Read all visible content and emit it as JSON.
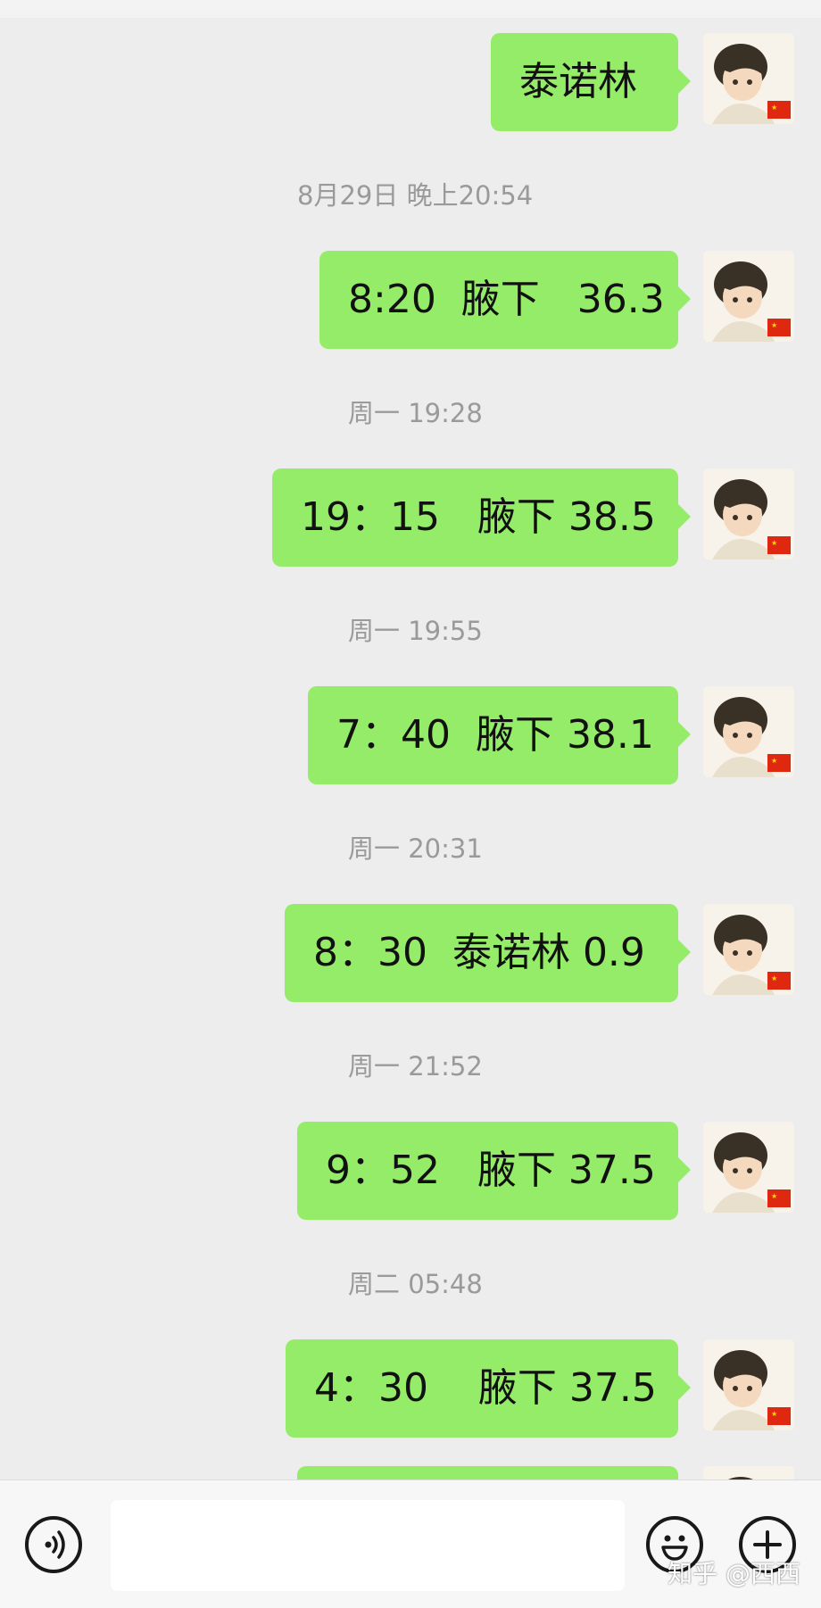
{
  "messages": [
    {
      "text": "泰诺林"
    },
    {
      "text": "8:20  腋下   36.3"
    },
    {
      "text": "19：15   腋下 38.5"
    },
    {
      "text": "7：40  腋下 38.1"
    },
    {
      "text": "8：30  泰诺林 0.9"
    },
    {
      "text": "9：52   腋下 37.5"
    },
    {
      "text": "4：30    腋下 37.5"
    }
  ],
  "timestamps": [
    "8月29日 晚上20:54",
    "周一 19:28",
    "周一 19:55",
    "周一 20:31",
    "周一 21:52",
    "周二 05:48"
  ],
  "input_bar": {
    "voice_icon": "voice-icon",
    "emoji_icon": "emoji-icon",
    "plus_icon": "plus-icon"
  },
  "watermark": "知乎 @西西",
  "colors": {
    "bubble": "#95ec69",
    "background": "#ededed",
    "timestamp": "#9a9a9a"
  }
}
